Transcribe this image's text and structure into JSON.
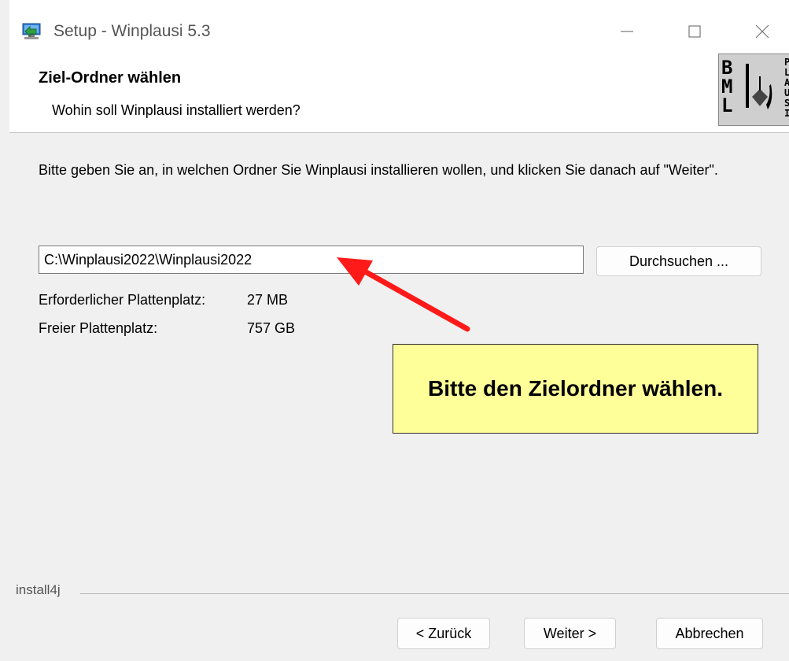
{
  "window": {
    "title": "Setup - Winplausi 5.3",
    "icon": "installer-computer-icon"
  },
  "header": {
    "title": "Ziel-Ordner wählen",
    "subtitle": "Wohin soll Winplausi installiert werden?",
    "logo": {
      "letters_large": [
        "B",
        "M",
        "L"
      ],
      "letters_small": [
        "P",
        "L",
        "A",
        "U",
        "S",
        "I"
      ]
    }
  },
  "content": {
    "intro": "Bitte geben Sie an, in welchen Ordner Sie Winplausi installieren wollen, und klicken Sie danach auf \"Weiter\".",
    "path_value": "C:\\Winplausi2022\\Winplausi2022",
    "browse_label": "Durchsuchen ...",
    "required_space_label": "Erforderlicher Plattenplatz:",
    "required_space_value": "27 MB",
    "free_space_label": "Freier Plattenplatz:",
    "free_space_value": "757 GB"
  },
  "annotation": {
    "callout_text": "Bitte den Zielordner wählen.",
    "arrow_color": "#ff1a1a",
    "callout_color": "#ffff99"
  },
  "footer": {
    "brand": "install4j",
    "back_label": "< Zurück",
    "next_label": "Weiter >",
    "cancel_label": "Abbrechen"
  }
}
